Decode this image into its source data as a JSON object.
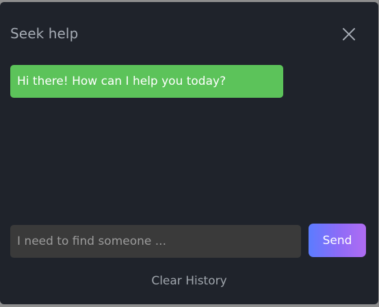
{
  "dialog": {
    "title": "Seek help",
    "close_icon": "close-icon"
  },
  "messages": [
    {
      "sender": "bot",
      "text": "Hi there! How can I help you today?"
    }
  ],
  "composer": {
    "input_placeholder": "I need to find someone ...",
    "input_value": "",
    "send_label": "Send"
  },
  "footer": {
    "clear_history_label": "Clear History"
  },
  "colors": {
    "background": "#1f232b",
    "bot_bubble": "#5cc35a",
    "input_bg": "#3a3a3a",
    "send_gradient_start": "#5b7cff",
    "send_gradient_end": "#b06cf2"
  }
}
